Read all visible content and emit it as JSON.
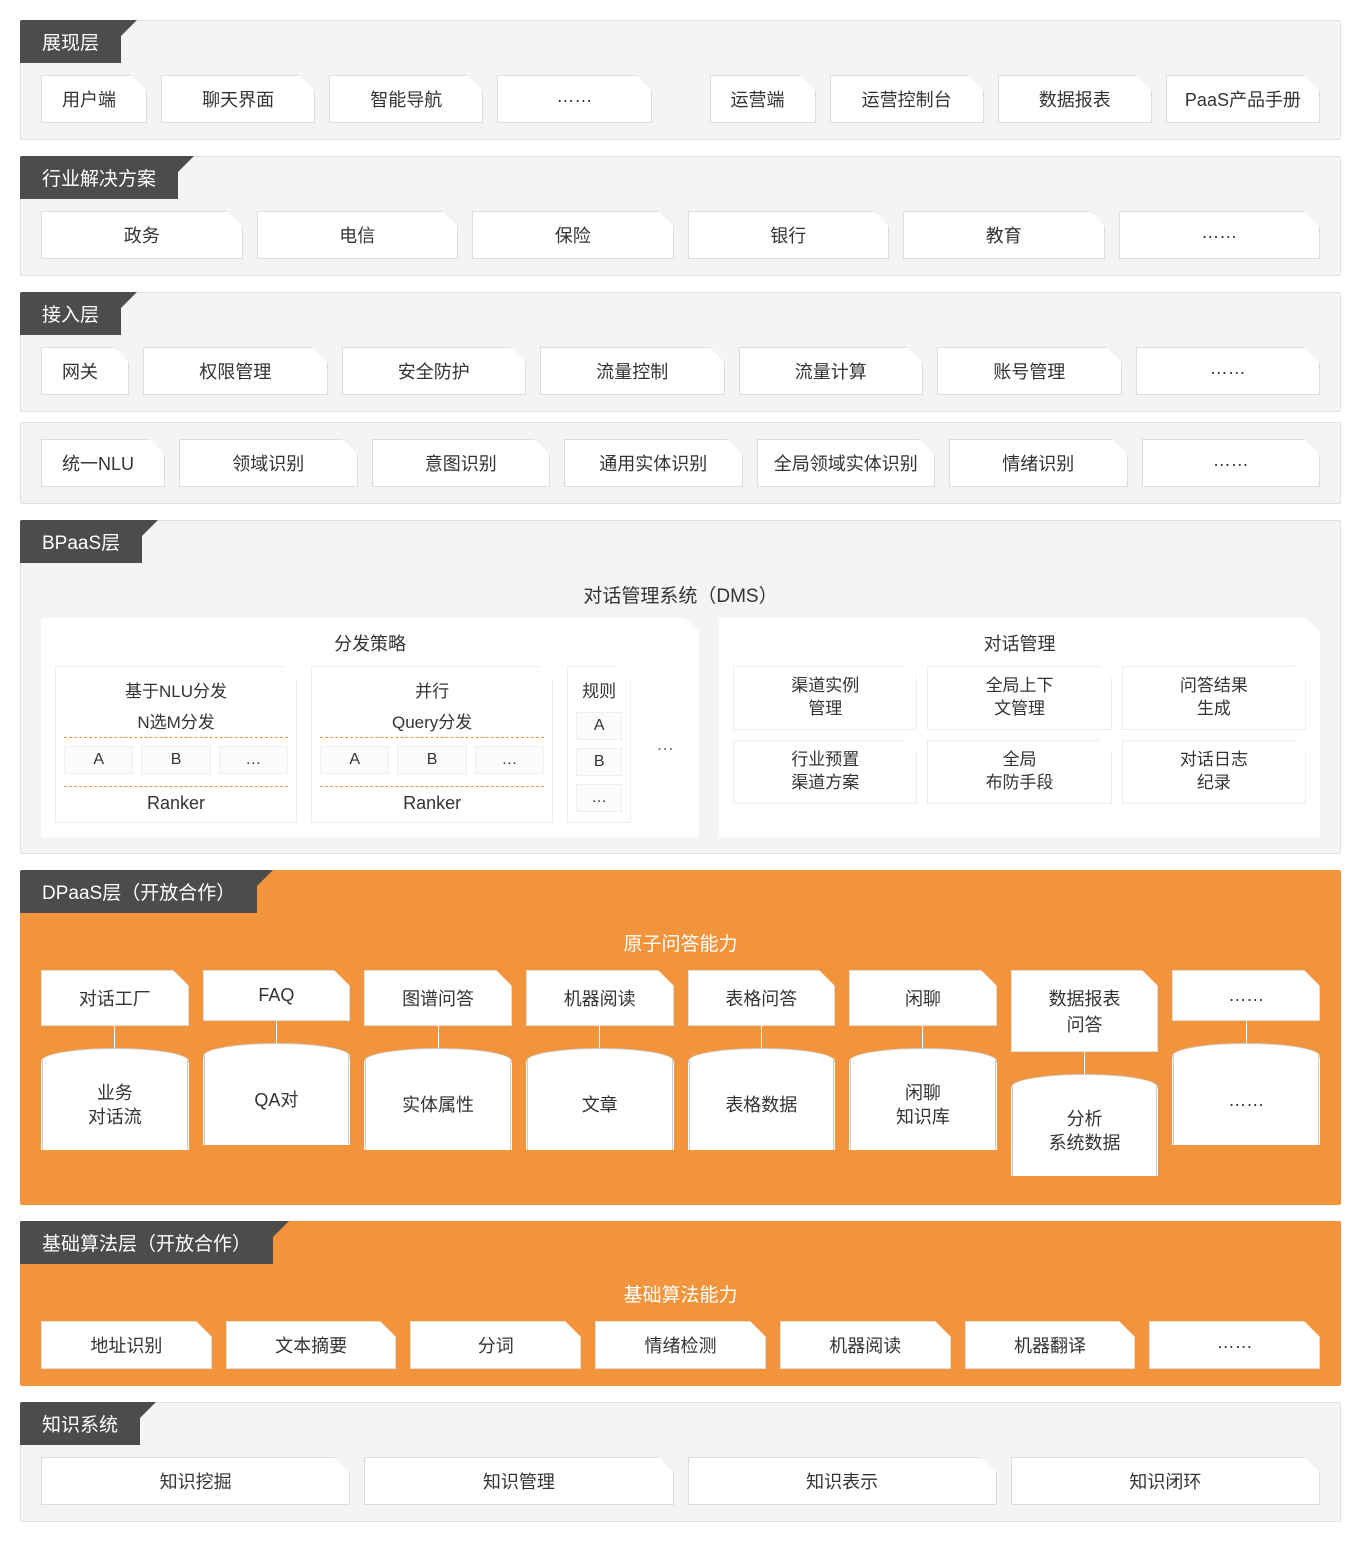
{
  "presentation": {
    "title": "展现层",
    "left_lead": "用户端",
    "left": [
      "聊天界面",
      "智能导航",
      "……"
    ],
    "right_lead": "运营端",
    "right": [
      "运营控制台",
      "数据报表",
      "PaaS产品手册"
    ]
  },
  "industry": {
    "title": "行业解决方案",
    "items": [
      "政务",
      "电信",
      "保险",
      "银行",
      "教育",
      "……"
    ]
  },
  "access": {
    "title": "接入层",
    "row1_lead": "网关",
    "row1": [
      "权限管理",
      "安全防护",
      "流量控制",
      "流量计算",
      "账号管理",
      "……"
    ],
    "row2_lead": "统一NLU",
    "row2": [
      "领域识别",
      "意图识别",
      "通用实体识别",
      "全局领域实体识别",
      "情绪识别",
      "……"
    ]
  },
  "bpaas": {
    "title": "BPaaS层",
    "dms_title": "对话管理系统（DMS）",
    "dispatch": {
      "title": "分发策略",
      "nlu": {
        "head1": "基于NLU分发",
        "head2": "N选M分发",
        "cells": [
          "A",
          "B",
          "…"
        ],
        "foot": "Ranker"
      },
      "parallel": {
        "head1": "并行",
        "head2": "Query分发",
        "cells": [
          "A",
          "B",
          "…"
        ],
        "foot": "Ranker"
      },
      "rule": {
        "head": "规则",
        "cells": [
          "A",
          "B",
          "…"
        ]
      },
      "more": "…"
    },
    "manage": {
      "title": "对话管理",
      "cells": [
        "渠道实例\n管理",
        "全局上下\n文管理",
        "问答结果\n生成",
        "行业预置\n渠道方案",
        "全局\n布防手段",
        "对话日志\n纪录"
      ]
    }
  },
  "dpaas": {
    "title": "DPaaS层（开放合作）",
    "section": "原子问答能力",
    "cols": [
      {
        "top": "对话工厂",
        "db": "业务\n对话流"
      },
      {
        "top": "FAQ",
        "db": "QA对"
      },
      {
        "top": "图谱问答",
        "db": "实体属性"
      },
      {
        "top": "机器阅读",
        "db": "文章"
      },
      {
        "top": "表格问答",
        "db": "表格数据"
      },
      {
        "top": "闲聊",
        "db": "闲聊\n知识库"
      },
      {
        "top": "数据报表\n问答",
        "db": "分析\n系统数据"
      },
      {
        "top": "……",
        "db": "……"
      }
    ]
  },
  "algo": {
    "title": "基础算法层（开放合作）",
    "section": "基础算法能力",
    "items": [
      "地址识别",
      "文本摘要",
      "分词",
      "情绪检测",
      "机器阅读",
      "机器翻译",
      "……"
    ]
  },
  "knowledge": {
    "title": "知识系统",
    "items": [
      "知识挖掘",
      "知识管理",
      "知识表示",
      "知识闭环"
    ]
  }
}
